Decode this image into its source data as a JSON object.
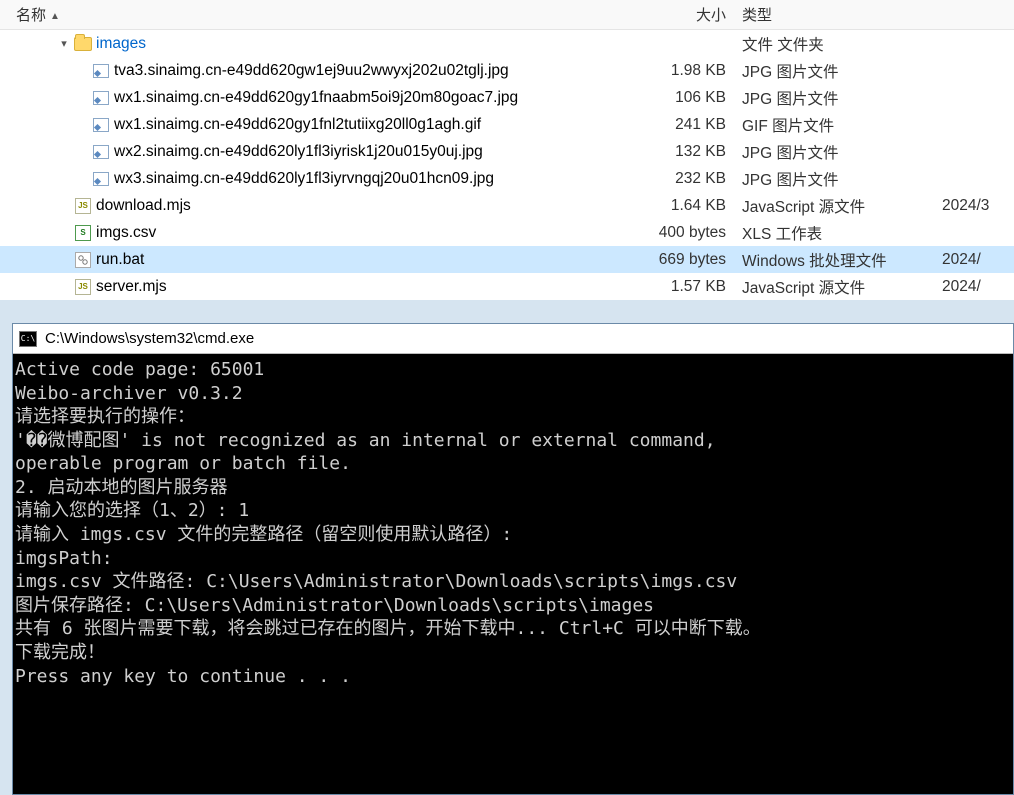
{
  "explorer": {
    "columns": {
      "name": "名称",
      "size": "大小",
      "type": "类型",
      "date": ""
    },
    "folder": {
      "name": "images",
      "type": "文件 文件夹"
    },
    "images": [
      {
        "name": "tva3.sinaimg.cn-e49dd620gw1ej9uu2wwyxj202u02tglj.jpg",
        "size": "1.98 KB",
        "type": "JPG 图片文件"
      },
      {
        "name": "wx1.sinaimg.cn-e49dd620gy1fnaabm5oi9j20m80goac7.jpg",
        "size": "106 KB",
        "type": "JPG 图片文件"
      },
      {
        "name": "wx1.sinaimg.cn-e49dd620gy1fnl2tutiixg20ll0g1agh.gif",
        "size": "241 KB",
        "type": "GIF 图片文件"
      },
      {
        "name": "wx2.sinaimg.cn-e49dd620ly1fl3iyrisk1j20u015y0uj.jpg",
        "size": "132 KB",
        "type": "JPG 图片文件"
      },
      {
        "name": "wx3.sinaimg.cn-e49dd620ly1fl3iyrvngqj20u01hcn09.jpg",
        "size": "232 KB",
        "type": "JPG 图片文件"
      }
    ],
    "files": [
      {
        "icon": "js",
        "name": "download.mjs",
        "size": "1.64 KB",
        "type": "JavaScript 源文件",
        "date": "2024/3"
      },
      {
        "icon": "csv",
        "name": "imgs.csv",
        "size": "400 bytes",
        "type": "XLS 工作表",
        "date": ""
      },
      {
        "icon": "bat",
        "name": "run.bat",
        "size": "669 bytes",
        "type": "Windows 批处理文件",
        "date": "2024/",
        "selected": true
      },
      {
        "icon": "js",
        "name": "server.mjs",
        "size": "1.57 KB",
        "type": "JavaScript 源文件",
        "date": "2024/"
      }
    ]
  },
  "cmd": {
    "title": "C:\\Windows\\system32\\cmd.exe",
    "lines": [
      "Active code page: 65001",
      "Weibo-archiver v0.3.2",
      "请选择要执行的操作：",
      "'��微博配图' is not recognized as an internal or external command,",
      "operable program or batch file.",
      "2. 启动本地的图片服务器",
      "请输入您的选择（1、2）: 1",
      "请输入 imgs.csv 文件的完整路径（留空则使用默认路径）:",
      "imgsPath:",
      "imgs.csv 文件路径: C:\\Users\\Administrator\\Downloads\\scripts\\imgs.csv",
      "图片保存路径: C:\\Users\\Administrator\\Downloads\\scripts\\images",
      "共有 6 张图片需要下载，将会跳过已存在的图片，开始下载中... Ctrl+C 可以中断下载。",
      "下载完成！",
      "Press any key to continue . . ."
    ]
  }
}
